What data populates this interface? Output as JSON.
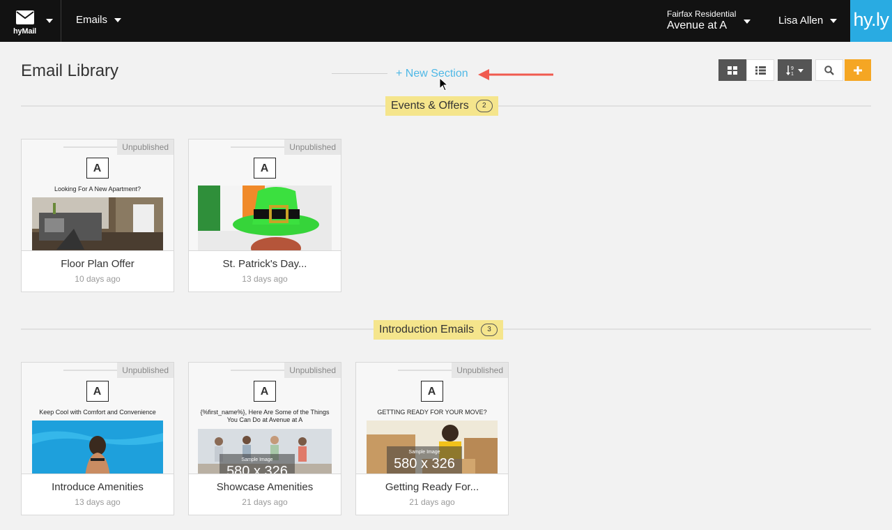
{
  "app": {
    "logo_label": "hyMail",
    "nav_emails": "Emails",
    "org_name": "Fairfax Residential",
    "property_name": "Avenue at A",
    "user_name": "Lisa Allen",
    "brand_logo": "hy.ly",
    "brand_color": "#29abe2"
  },
  "page": {
    "title": "Email Library",
    "new_section": "+ New Section",
    "toolbar": {
      "grid_icon": "grid-view-icon",
      "list_icon": "list-view-icon",
      "sort_icon": "sort-numeric-icon",
      "search_icon": "search-icon",
      "add_icon": "plus-icon",
      "add_color": "#f5a623"
    }
  },
  "sections": [
    {
      "name": "Events & Offers",
      "count": "2",
      "cards": [
        {
          "status": "Unpublished",
          "title": "Floor Plan Offer",
          "date": "10 days ago",
          "brand": "A",
          "headline": "Looking For A New Apartment?"
        },
        {
          "status": "Unpublished",
          "title": "St. Patrick's Day...",
          "date": "13 days ago",
          "brand": "A"
        }
      ]
    },
    {
      "name": "Introduction Emails",
      "count": "3",
      "cards": [
        {
          "status": "Unpublished",
          "title": "Introduce Amenities",
          "date": "13 days ago",
          "brand": "A",
          "headline": "Keep Cool with Comfort and Convenience"
        },
        {
          "status": "Unpublished",
          "title": "Showcase Amenities",
          "date": "21 days ago",
          "brand": "A",
          "headline": "{%first_name%}, Here Are Some of the Things You Can Do at Avenue at A",
          "sample_label": "Sample Image",
          "sample_size": "580 x 326"
        },
        {
          "status": "Unpublished",
          "title": "Getting Ready For...",
          "date": "21 days ago",
          "brand": "A",
          "headline": "GETTING READY FOR YOUR MOVE?",
          "sample_label": "Sample Image",
          "sample_size": "580 x 326"
        }
      ]
    }
  ]
}
